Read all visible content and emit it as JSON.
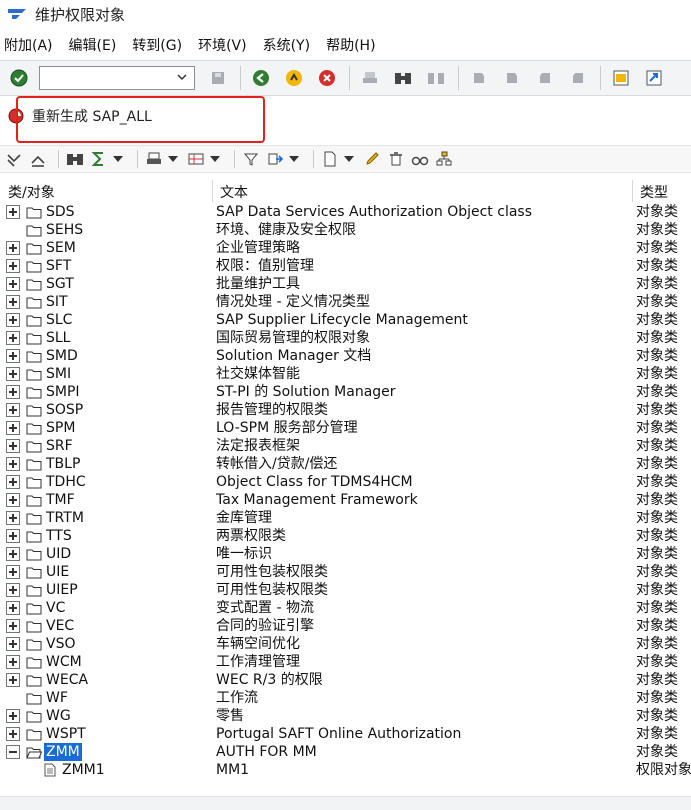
{
  "window": {
    "title": "维护权限对象"
  },
  "menu": [
    "附加(A)",
    "编辑(E)",
    "转到(G)",
    "环境(V)",
    "系统(Y)",
    "帮助(H)"
  ],
  "command_field": {
    "value": ""
  },
  "app_toolbar": {
    "regenerate_label": "重新生成 SAP_ALL"
  },
  "tree": {
    "columns": {
      "object": "类/对象",
      "text": "文本",
      "type": "类型"
    },
    "rows": [
      {
        "name": "SDS",
        "text": "SAP Data Services Authorization Object class",
        "type": "对象类",
        "expander": "plus"
      },
      {
        "name": "SEHS",
        "text": "环境、健康及安全权限",
        "type": "对象类",
        "expander": "none"
      },
      {
        "name": "SEM",
        "text": "企业管理策略",
        "type": "对象类",
        "expander": "plus"
      },
      {
        "name": "SFT",
        "text": "权限：值别管理",
        "type": "对象类",
        "expander": "plus"
      },
      {
        "name": "SGT",
        "text": "批量维护工具",
        "type": "对象类",
        "expander": "plus"
      },
      {
        "name": "SIT",
        "text": "情况处理 - 定义情况类型",
        "type": "对象类",
        "expander": "plus"
      },
      {
        "name": "SLC",
        "text": "SAP Supplier Lifecycle Management",
        "type": "对象类",
        "expander": "plus"
      },
      {
        "name": "SLL",
        "text": "国际贸易管理的权限对象",
        "type": "对象类",
        "expander": "plus"
      },
      {
        "name": "SMD",
        "text": "Solution Manager 文档",
        "type": "对象类",
        "expander": "plus"
      },
      {
        "name": "SMI",
        "text": "社交媒体智能",
        "type": "对象类",
        "expander": "plus"
      },
      {
        "name": "SMPI",
        "text": "ST-PI 的 Solution Manager",
        "type": "对象类",
        "expander": "plus"
      },
      {
        "name": "SOSP",
        "text": "报告管理的权限类",
        "type": "对象类",
        "expander": "plus"
      },
      {
        "name": "SPM",
        "text": "LO-SPM 服务部分管理",
        "type": "对象类",
        "expander": "plus"
      },
      {
        "name": "SRF",
        "text": "法定报表框架",
        "type": "对象类",
        "expander": "plus"
      },
      {
        "name": "TBLP",
        "text": "转帐借入/贷款/偿还",
        "type": "对象类",
        "expander": "plus"
      },
      {
        "name": "TDHC",
        "text": "Object Class for TDMS4HCM",
        "type": "对象类",
        "expander": "plus"
      },
      {
        "name": "TMF",
        "text": "Tax Management Framework",
        "type": "对象类",
        "expander": "plus"
      },
      {
        "name": "TRTM",
        "text": "金库管理",
        "type": "对象类",
        "expander": "plus"
      },
      {
        "name": "TTS",
        "text": "两票权限类",
        "type": "对象类",
        "expander": "plus"
      },
      {
        "name": "UID",
        "text": "唯一标识",
        "type": "对象类",
        "expander": "plus"
      },
      {
        "name": "UIE",
        "text": "可用性包装权限类",
        "type": "对象类",
        "expander": "plus"
      },
      {
        "name": "UIEP",
        "text": "可用性包装权限类",
        "type": "对象类",
        "expander": "plus"
      },
      {
        "name": "VC",
        "text": "变式配置 - 物流",
        "type": "对象类",
        "expander": "plus"
      },
      {
        "name": "VEC",
        "text": "合同的验证引擎",
        "type": "对象类",
        "expander": "plus"
      },
      {
        "name": "VSO",
        "text": "车辆空间优化",
        "type": "对象类",
        "expander": "plus"
      },
      {
        "name": "WCM",
        "text": "工作清理管理",
        "type": "对象类",
        "expander": "plus"
      },
      {
        "name": "WECA",
        "text": "WEC R/3 的权限",
        "type": "对象类",
        "expander": "plus"
      },
      {
        "name": "WF",
        "text": "工作流",
        "type": "对象类",
        "expander": "none"
      },
      {
        "name": "WG",
        "text": "零售",
        "type": "对象类",
        "expander": "plus"
      },
      {
        "name": "WSPT",
        "text": "Portugal SAFT Online Authorization",
        "type": "对象类",
        "expander": "plus"
      },
      {
        "name": "ZMM",
        "text": "AUTH FOR MM",
        "type": "对象类",
        "expander": "minus",
        "selected": true
      }
    ],
    "child_row": {
      "name": "ZMM1",
      "text": "MM1",
      "type": "权限对象"
    }
  }
}
